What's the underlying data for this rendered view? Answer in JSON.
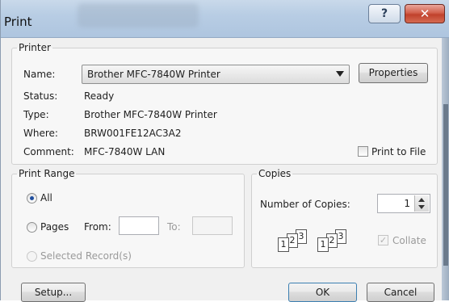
{
  "window": {
    "title": "Print",
    "help_glyph": "?",
    "close_glyph": "✕"
  },
  "printer": {
    "legend": "Printer",
    "name_label": "Name:",
    "name_value": "Brother MFC-7840W Printer",
    "properties_label": "Properties",
    "status_label": "Status:",
    "status_value": "Ready",
    "type_label": "Type:",
    "type_value": "Brother MFC-7840W Printer",
    "where_label": "Where:",
    "where_value": "BRW001FE12AC3A2",
    "comment_label": "Comment:",
    "comment_value": "MFC-7840W LAN",
    "print_to_file_label": "Print to File"
  },
  "print_range": {
    "legend": "Print Range",
    "all_label": "All",
    "pages_label": "Pages",
    "from_label": "From:",
    "to_label": "To:",
    "selected_label": "Selected Record(s)"
  },
  "copies": {
    "legend": "Copies",
    "number_label": "Number of Copies:",
    "number_value": "1",
    "collate_label": "Collate",
    "collate_pages": [
      "1",
      "2",
      "3"
    ]
  },
  "buttons": {
    "setup_label": "Setup...",
    "ok_label": "OK",
    "cancel_label": "Cancel"
  }
}
